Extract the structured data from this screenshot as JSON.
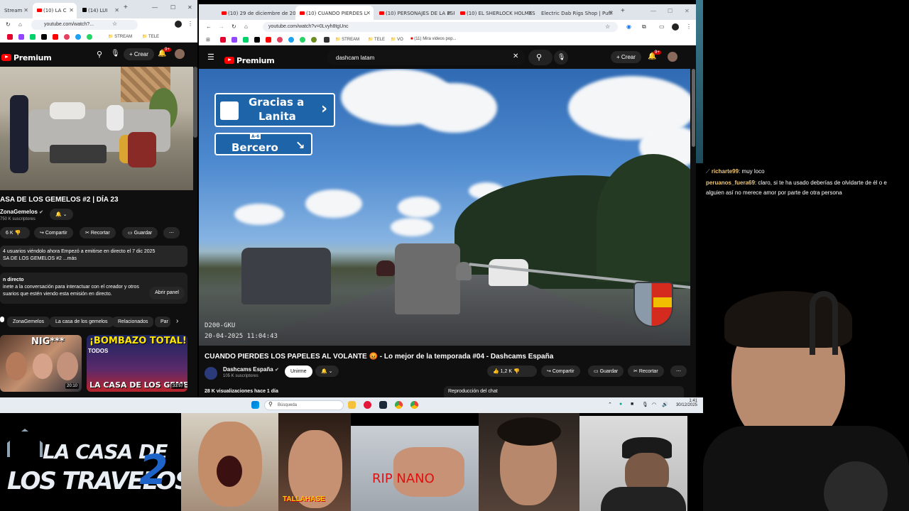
{
  "left_browser": {
    "tabs": [
      "Stream",
      "(10) LA C",
      "(14) LUI"
    ],
    "url": "youtube.com/watch?...",
    "bookmark_stream": "STREAM",
    "bookmark_tele": "TELE",
    "logo": "Premium",
    "create_label": "Crear",
    "notif_count": "9+",
    "video_title": "ASA DE LOS GEMELOS #2 | DÍA 23",
    "channel_name": "ZonaGemelos",
    "subscribers": "750 K suscriptores",
    "likes": "6 K",
    "share_label": "Compartir",
    "clip_label": "Recortar",
    "save_label": "Guardar",
    "desc_line1": "4 usuarios viéndolo ahora  Empezó a emitirse en directo el 7 dic 2025",
    "desc_line2": "SA DE LOS GEMELOS #2 ...más",
    "chat_title": "n directo",
    "chat_text1": "inete a la conversación para interactuar con el creador y otros",
    "chat_text2": "suarios que estén viendo esta emisión en directo.",
    "open_panel": "Abrir panel",
    "chips": [
      "ZonaGemelos",
      "La casa de los gemelos",
      "Relacionados",
      "Par"
    ],
    "thumb1_title": "NIG***",
    "thumb1_duration": "20:10",
    "thumb2_title": "¡BOMBAZO TOTAL!",
    "thumb2_sub": "TODOS",
    "thumb2_bottom": "LA CASA DE LOS GEMELO",
    "thumb2_duration": "33:57"
  },
  "main_browser": {
    "tabs": [
      "(10) 29 de diciembre de 2025",
      "(10) CUANDO PIERDES L",
      "(10) PERSONAJES DE LA ESP",
      "(10) EL SHERLOCK HOLMES",
      "Electric Dab Rigs Shop | Puff"
    ],
    "url": "youtube.com/watch?v=0Lvyh8tgUnc",
    "bookmarks": [
      "STREAM",
      "TELE",
      "VO",
      "(11) Mira videos pop..."
    ],
    "logo": "Premium",
    "search_value": "dashcam latam",
    "create_label": "Crear",
    "notif_count": "9+",
    "sign1": "Gracias a Lanita",
    "sign1_a": "Gracias a",
    "sign1_b": "Lanita",
    "sign2_road": "A-6",
    "sign2": "Bercero",
    "osd_id": "D200-GKU",
    "osd_time": "20-04-2025  11:04:43",
    "video_title": "CUANDO PIERDES LOS PAPELES AL VOLANTE 😡 - Lo mejor de la temporada #04 - Dashcams España",
    "channel_name": "Dashcams España",
    "subscribers": "105 K suscriptores",
    "subscribe_label": "Unirme",
    "likes": "1,2 K",
    "share_label": "Compartir",
    "save_label": "Guardar",
    "clip_label": "Recortar",
    "views_meta": "28 K visualizaciones  hace 1 día",
    "chat_replay": "Reproducción del chat"
  },
  "taskbar": {
    "search_placeholder": "Búsqueda",
    "time": "1:41",
    "date": "30/12/2025"
  },
  "twitch_chat": [
    {
      "user": "richarte99",
      "message": ": muy loco"
    },
    {
      "user": "peruanos_fuera69",
      "message": ": claro, si te ha usado deberías de olvidarte de él o e"
    },
    {
      "user": "",
      "message": "alguien así no merece amor por parte de otra persona"
    }
  ],
  "overlay": {
    "logo_line1": "LA CASA DE",
    "logo_line2": "LOS TRAVELOS",
    "logo_num": "2",
    "clip2_caption": "TALLAHASE",
    "clip3_caption": "RIP NANO"
  }
}
